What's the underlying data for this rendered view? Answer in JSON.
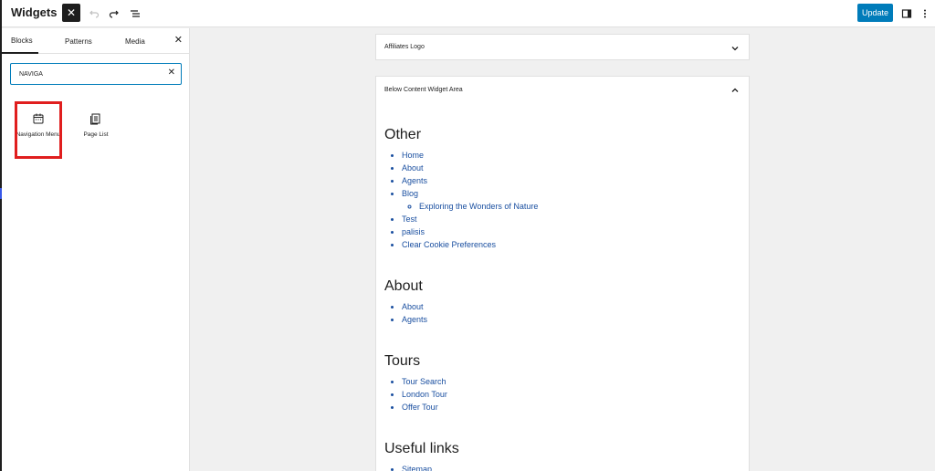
{
  "header": {
    "title": "Widgets",
    "update_label": "Update"
  },
  "inserter": {
    "tabs": [
      "Blocks",
      "Patterns",
      "Media"
    ],
    "search_value": "NAVIGA",
    "blocks": [
      {
        "label": "Navigation Menu",
        "icon": "navigation-icon"
      },
      {
        "label": "Page List",
        "icon": "page-list-icon"
      }
    ]
  },
  "areas": [
    {
      "title": "Affiliates Logo",
      "expanded": false
    },
    {
      "title": "Below Content Widget Area",
      "expanded": true
    }
  ],
  "widgets": {
    "other": {
      "title": "Other",
      "items": [
        "Home",
        "About",
        "Agents",
        "Blog"
      ],
      "blog_sub": [
        "Exploring the Wonders of Nature"
      ],
      "items_after": [
        "Test",
        "palisis",
        "Clear Cookie Preferences"
      ]
    },
    "about": {
      "title": "About",
      "items": [
        "About",
        "Agents"
      ]
    },
    "tours": {
      "title": "Tours",
      "items": [
        "Tour Search",
        "London Tour",
        "Offer Tour"
      ]
    },
    "useful": {
      "title": "Useful links",
      "items": [
        "Sitemap"
      ]
    }
  },
  "colors": {
    "accent": "#007cba",
    "highlight": "#e01e1e",
    "link": "#1a4fa0"
  }
}
